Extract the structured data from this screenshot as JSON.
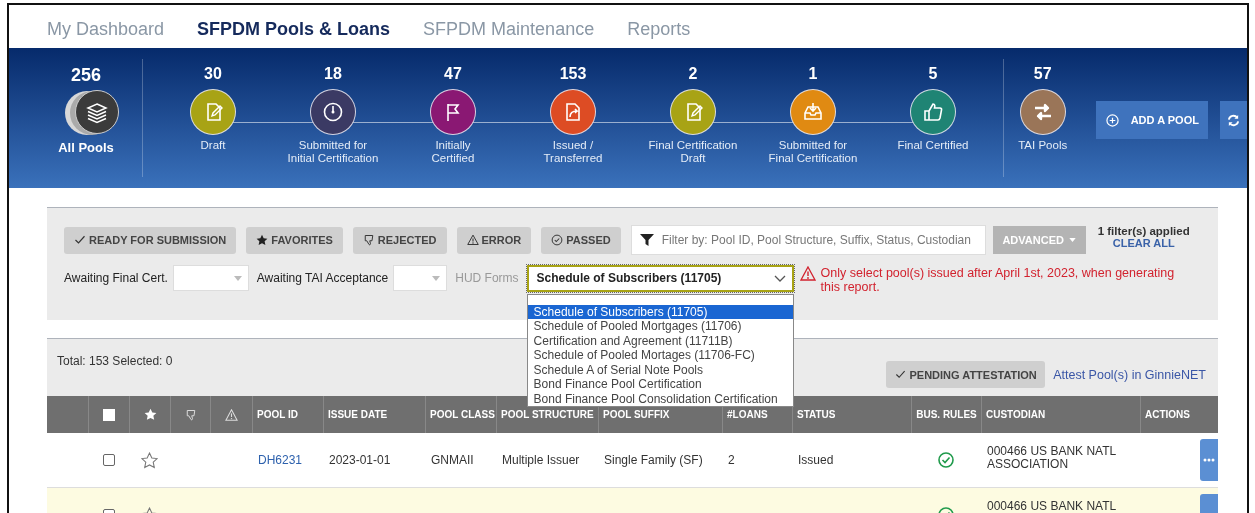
{
  "nav": {
    "tabs": [
      {
        "label": "My Dashboard",
        "selected": false
      },
      {
        "label": "SFPDM Pools & Loans",
        "selected": true
      },
      {
        "label": "SFPDM Maintenance",
        "selected": false
      },
      {
        "label": "Reports",
        "selected": false
      }
    ]
  },
  "banner": {
    "all_pools": {
      "count": "256",
      "label": "All Pools"
    },
    "stages": [
      {
        "count": "30",
        "label": "Draft",
        "color": "#a8a315"
      },
      {
        "count": "18",
        "label": "Submitted for\nInitial Certification",
        "color": "#3b3a64"
      },
      {
        "count": "47",
        "label": "Initially\nCertified",
        "color": "#8a1873"
      },
      {
        "count": "153",
        "label": "Issued /\nTransferred",
        "color": "#dd4c24"
      },
      {
        "count": "2",
        "label": "Final Certification\nDraft",
        "color": "#a8a315"
      },
      {
        "count": "1",
        "label": "Submitted for\nFinal Certification",
        "color": "#e08a12"
      },
      {
        "count": "5",
        "label": "Final Certified",
        "color": "#1f8474"
      }
    ],
    "tai": {
      "count": "57",
      "label": "TAI Pools",
      "color": "#9a7558"
    },
    "add_button": "ADD A POOL"
  },
  "filters": {
    "quick_buttons": [
      "READY FOR SUBMISSION",
      "FAVORITES",
      "REJECTED",
      "ERROR",
      "PASSED"
    ],
    "search": {
      "placeholder": "Filter by: Pool ID, Pool Structure, Suffix, Status, Custodian"
    },
    "advanced_button": "ADVANCED",
    "applied": "1 filter(s) applied",
    "clear_all": "CLEAR ALL",
    "awaiting_final_cert": {
      "label": "Awaiting Final Cert."
    },
    "awaiting_tai": {
      "label": "Awaiting TAI Acceptance"
    },
    "hud_forms": {
      "label": "HUD Forms",
      "value": "Schedule of Subscribers (11705)",
      "expanded": true,
      "options": [
        {
          "label": "Schedule of Subscribers (11705)",
          "selected": true
        },
        {
          "label": "Schedule of Pooled Mortgages (11706)",
          "selected": false
        },
        {
          "label": "Certification and Agreement (11711B)",
          "selected": false
        },
        {
          "label": "Schedule of Pooled Mortages (11706-FC)",
          "selected": false
        },
        {
          "label": "Schedule A of Serial Note Pools",
          "selected": false
        },
        {
          "label": "Bond Finance Pool Certification",
          "selected": false
        },
        {
          "label": "Bond Finance Pool Consolidation Certification",
          "selected": false
        }
      ]
    },
    "warning": "Only select pool(s) issued after April 1st, 2023, when generating this report."
  },
  "summary": {
    "totals": "Total: 153 Selected: 0",
    "pending_button": "PENDING ATTESTATION",
    "attest_link": "Attest Pool(s) in GinnieNET"
  },
  "table": {
    "select_all_checked": false,
    "columns": [
      "POOL ID",
      "ISSUE DATE",
      "POOL CLASS",
      "POOL STRUCTURE",
      "POOL SUFFIX",
      "#LOANS",
      "STATUS",
      "BUS. RULES",
      "CUSTODIAN",
      "ACTIONS"
    ],
    "rows": [
      {
        "pool_id": "DH6231",
        "issue_date": "2023-01-01",
        "pool_class": "GNMAII",
        "pool_structure": "Multiple Issuer",
        "pool_suffix": "Single Family (SF)",
        "loans": "2",
        "status": "Issued",
        "custodian": "000466 US BANK NATL ASSOCIATION",
        "checked": false,
        "favorite": false,
        "bus_rules_passed": true,
        "highlighted": false
      },
      {
        "custodian": "000466 US BANK NATL",
        "checked": false,
        "favorite": false,
        "bus_rules_passed": true,
        "highlighted": true
      }
    ]
  }
}
